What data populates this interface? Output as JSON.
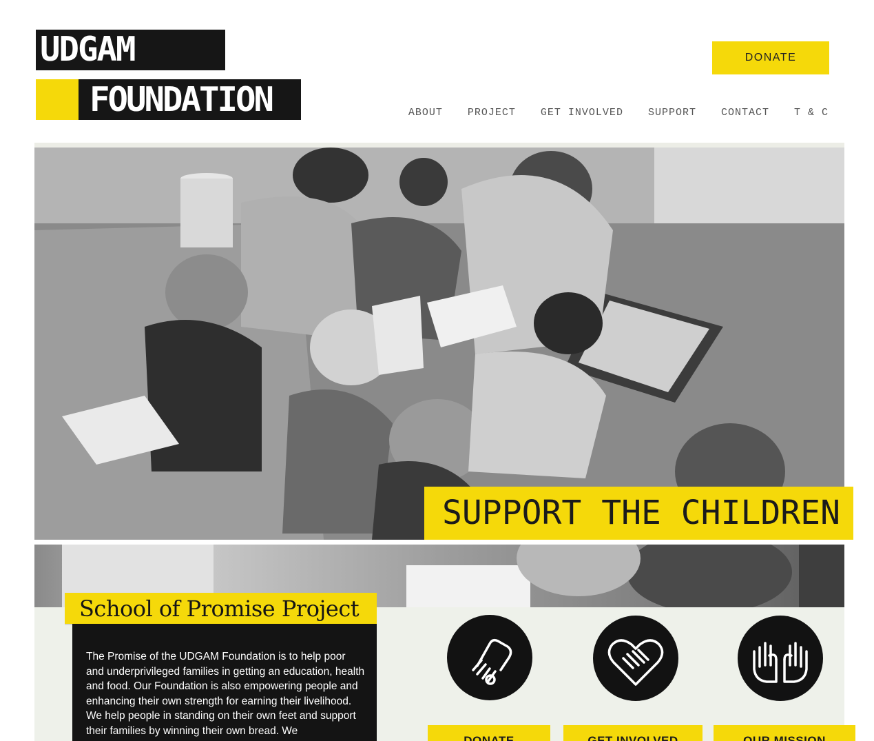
{
  "logo": {
    "line1": "UDGAM",
    "line2": "FOUNDATION"
  },
  "header": {
    "donate_label": "DONATE"
  },
  "nav": [
    "ABOUT",
    "PROJECT",
    "GET INVOLVED",
    "SUPPORT",
    "CONTACT",
    "T & C"
  ],
  "hero": {
    "banner": "SUPPORT THE CHILDREN"
  },
  "promise": {
    "title": "School of Promise Project",
    "text": "The Promise of the UDGAM Foundation is to help poor and underprivileged families in getting an education, health and food. Our Foundation is also empowering people and enhancing their own strength for earning their livelihood. We help people in standing on their own feet and support their families by winning their own bread. We"
  },
  "actions": {
    "icons": [
      "hand-coin-icon",
      "handshake-heart-icon",
      "open-hands-icon"
    ],
    "buttons": [
      "DONATE",
      "GET INVOLVED",
      "OUR MISSION"
    ]
  },
  "colors": {
    "accent": "#f5d90a",
    "dark": "#141414",
    "panel": "#eef1ea"
  }
}
